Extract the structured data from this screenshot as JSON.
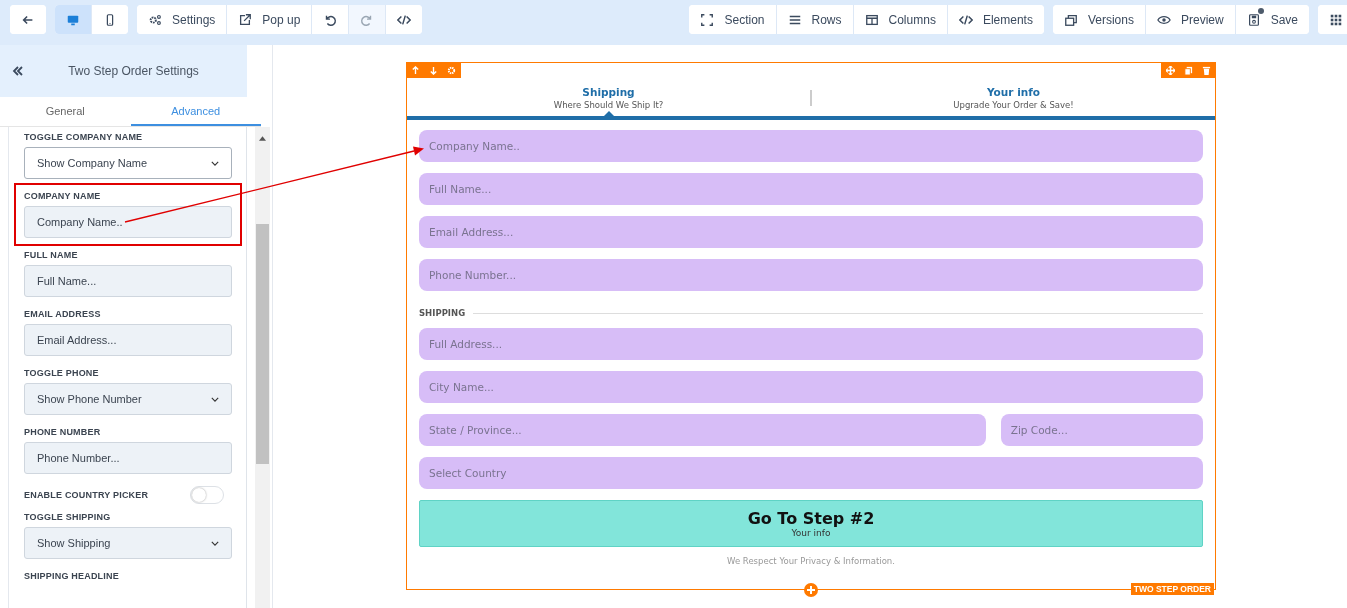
{
  "toolbar": {
    "left": [
      [
        {
          "selected": true
        },
        {
          "selected": false
        }
      ],
      [
        {
          "label": "Settings",
          "disabled": false
        },
        {
          "label": "Pop up",
          "disabled": false
        },
        {
          "disabled": false
        },
        {
          "disabled": true
        },
        {
          "disabled": false
        }
      ]
    ],
    "right": [
      [
        {
          "label": "Section"
        },
        {
          "label": "Rows"
        },
        {
          "label": "Columns"
        },
        {
          "label": "Elements"
        }
      ],
      [
        {
          "label": "Versions"
        },
        {
          "label": "Preview"
        },
        {
          "label": "Save",
          "dot": true
        }
      ]
    ]
  },
  "panel": {
    "title": "Two Step Order Settings",
    "tabs": [
      {
        "label": "General",
        "selected": false
      },
      {
        "label": "Advanced",
        "selected": true
      }
    ],
    "settings": [
      {
        "kind": "select",
        "label": "TOGGLE COMPANY NAME",
        "value": "Show Company Name",
        "highlighted": false
      },
      {
        "kind": "input",
        "label": "COMPANY NAME",
        "value": "Company Name..",
        "highlighted": true
      },
      {
        "kind": "input",
        "label": "FULL NAME",
        "value": "Full Name...",
        "highlighted": false
      },
      {
        "kind": "input",
        "label": "EMAIL ADDRESS",
        "value": "Email Address...",
        "highlighted": false
      },
      {
        "kind": "select",
        "label": "TOGGLE PHONE",
        "value": "Show Phone Number",
        "highlighted": false
      },
      {
        "kind": "input",
        "label": "PHONE NUMBER",
        "value": "Phone Number...",
        "highlighted": false
      },
      {
        "kind": "toggle",
        "label": "ENABLE COUNTRY PICKER",
        "on": false,
        "highlighted": false
      },
      {
        "kind": "select",
        "label": "TOGGLE SHIPPING",
        "value": "Show Shipping",
        "highlighted": false
      },
      {
        "kind": "heading",
        "label": "SHIPPING HEADLINE",
        "highlighted": false
      }
    ]
  },
  "form": {
    "badge": "TWO STEP ORDER",
    "steps": [
      {
        "title": "Shipping",
        "subtitle": "Where Should We Ship It?",
        "selected": true
      },
      {
        "title": "Your info",
        "subtitle": "Upgrade Your Order & Save!",
        "selected": false
      }
    ],
    "fields": [
      {
        "placeholder": "Company Name.."
      },
      {
        "placeholder": "Full Name..."
      },
      {
        "placeholder": "Email Address..."
      },
      {
        "placeholder": "Phone Number..."
      }
    ],
    "shipping": {
      "heading": "SHIPPING",
      "rows": [
        [
          {
            "placeholder": "Full Address..."
          }
        ],
        [
          {
            "placeholder": "City Name..."
          }
        ],
        [
          {
            "placeholder": "State / Province..."
          },
          {
            "placeholder": "Zip Code..."
          }
        ],
        [
          {
            "placeholder": "Select Country"
          }
        ]
      ]
    },
    "button": {
      "title": "Go To Step #2",
      "subtitle": "Your info"
    },
    "footer": "We Respect Your Privacy & Information."
  }
}
